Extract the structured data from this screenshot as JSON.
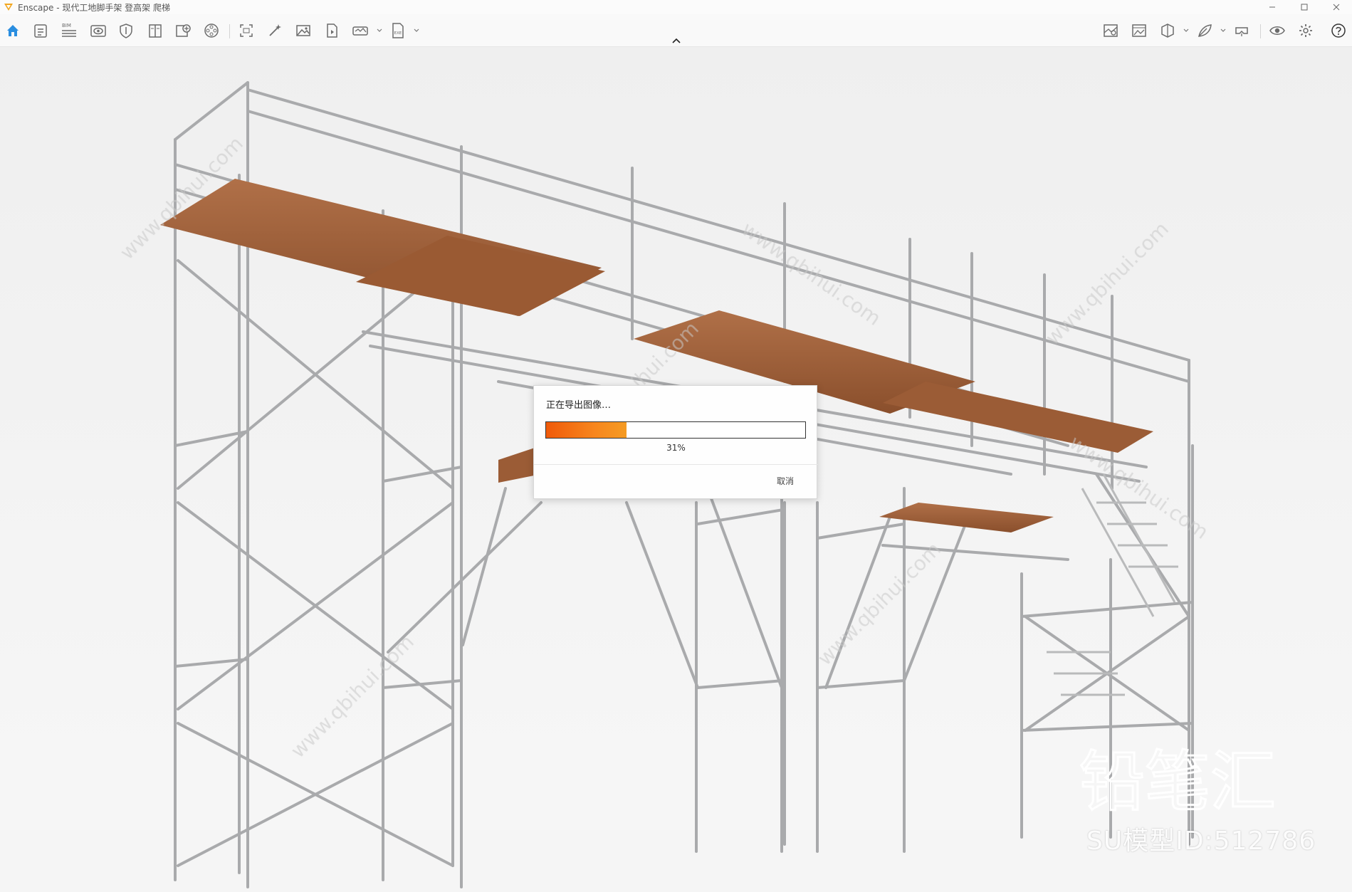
{
  "window": {
    "title": "Enscape - 现代工地脚手架 登高架 爬梯",
    "controls": [
      "minimize",
      "maximize",
      "close"
    ]
  },
  "toolbar": {
    "left_tools": [
      {
        "icon": "home-icon",
        "active": true,
        "label": ""
      },
      {
        "icon": "clipboard-icon",
        "label": ""
      },
      {
        "icon": "bim-icon",
        "label": "BIM"
      },
      {
        "icon": "view-icon",
        "label": ""
      },
      {
        "icon": "shield-icon",
        "label": ""
      },
      {
        "icon": "book-icon",
        "label": ""
      },
      {
        "icon": "asset-import-icon",
        "label": ""
      },
      {
        "icon": "film-reel-icon",
        "label": ""
      },
      {
        "icon": "screenshot-icon",
        "label": ""
      },
      {
        "icon": "magic-wand-icon",
        "label": ""
      },
      {
        "icon": "image-icon",
        "label": ""
      },
      {
        "icon": "batch-render-icon",
        "label": ""
      },
      {
        "icon": "panorama-360-icon",
        "label": ""
      },
      {
        "icon": "exe-export-icon",
        "label": "EXE"
      }
    ],
    "right_tools": [
      {
        "icon": "map-icon"
      },
      {
        "icon": "gallery-icon"
      },
      {
        "icon": "section-cube-icon"
      },
      {
        "icon": "leaf-brush-icon"
      },
      {
        "icon": "vr-headset-icon"
      },
      {
        "icon": "eye-icon"
      },
      {
        "icon": "settings-icon"
      },
      {
        "icon": "help-icon"
      }
    ],
    "accent_color": "#2a8ee0"
  },
  "export_dialog": {
    "title": "正在导出图像…",
    "progress": 0.31,
    "progress_label": "31%",
    "cancel_label": "取消",
    "progress_colors": [
      "#f05a0a",
      "#f59b22"
    ]
  },
  "watermark": {
    "brand_text": "铅笔汇",
    "model_id": "SU模型ID:512786",
    "site_text": "www.qbihui.com"
  }
}
